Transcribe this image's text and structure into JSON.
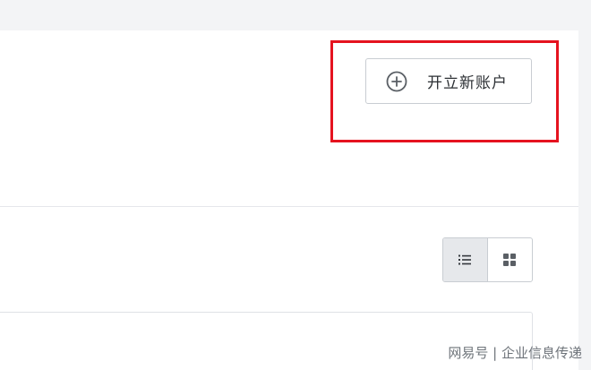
{
  "toolbar": {
    "new_account_label": "开立新账户",
    "plus_icon": "plus-circle-icon"
  },
  "view_toggle": {
    "active": "list",
    "list_icon": "list-view-icon",
    "grid_icon": "grid-view-icon"
  },
  "watermark": {
    "text": "网易号 | 企业信息传递"
  },
  "colors": {
    "highlight": "#e5131f",
    "page_bg": "#f3f4f6",
    "card_bg": "#ffffff",
    "border": "#c9cdd2"
  }
}
